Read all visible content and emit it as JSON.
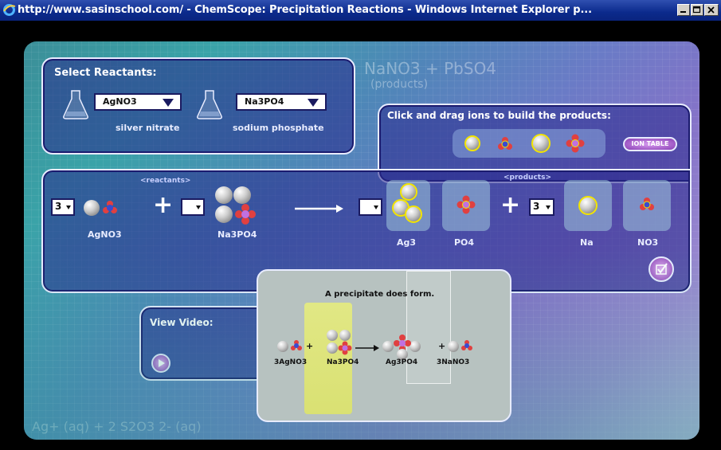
{
  "window": {
    "title": "http://www.sasinschool.com/ - ChemScope: Precipitation Reactions - Windows Internet Explorer p..."
  },
  "reactants_panel": {
    "heading": "Select Reactants:",
    "reactant1": {
      "formula": "AgNO3",
      "name": "silver nitrate"
    },
    "reactant2": {
      "formula": "Na3PO4",
      "name": "sodium phosphate"
    }
  },
  "ions_panel": {
    "heading": "Click and drag ions to build the products:",
    "ion_table_label": "ION TABLE"
  },
  "equation": {
    "reactants_label": "<reactants>",
    "products_label": "<products>",
    "coef1": "3",
    "coef2": "",
    "coef3": "",
    "coef4": "3",
    "label1": "AgNO3",
    "label2": "Na3PO4",
    "product_labels": [
      "Ag3",
      "PO4",
      "Na",
      "NO3"
    ]
  },
  "video": {
    "heading": "View Video:",
    "status": "A precipitate does form.",
    "captions": [
      "3AgNO3",
      "Na3PO4",
      "Ag3PO4",
      "3NaNO3"
    ]
  },
  "background_text": {
    "top": "NaNO3 + PbSO4",
    "products": "(products)",
    "bottom": "Ag+ (aq) + 2 S2O3 2- (aq)"
  },
  "colors": {
    "panel": "#2a2a8c",
    "accent_yellow": "#f2e400",
    "ion_button": "#a04fc0"
  }
}
